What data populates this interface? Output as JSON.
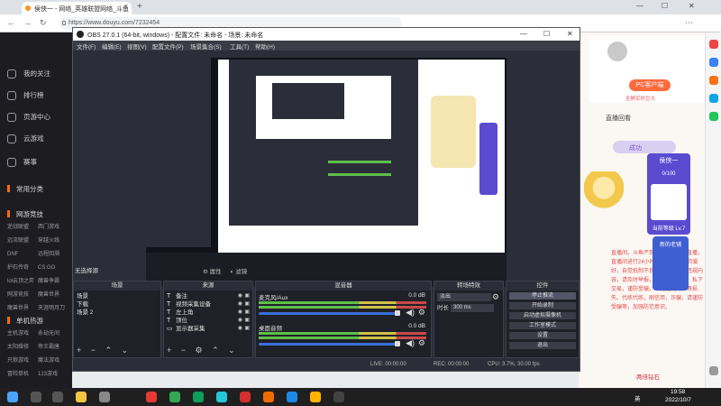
{
  "browser": {
    "tab_title": "侯侠一 - 网络_英雄联盟网络_斗鱼",
    "url": "https://www.douyu.com/7232454",
    "new_tab_symbol": "+",
    "close_symbol": "×",
    "win_min": "—",
    "win_max": "☐",
    "win_close": "✕"
  },
  "sidebar": {
    "items": [
      {
        "label": "我的关注"
      },
      {
        "label": "排行榜"
      },
      {
        "label": "页游中心"
      },
      {
        "label": "云游戏"
      },
      {
        "label": "赛事"
      }
    ],
    "section_common": "常用分类",
    "section_online": "网游竞技",
    "online_games": [
      "逆战联盟",
      "西门游戏",
      "远流联盟",
      "穿越火线",
      "DNF",
      "远程回溯",
      "护石传奇",
      "CS:GO",
      "lol云顶之弈",
      "魔兽争霸",
      "网游竞技",
      "魔兽世界",
      "魔兽世界",
      "天涯明月刀"
    ],
    "section_mobile": "单机热游",
    "mobile_games": [
      "主机游戏",
      "永劫无间",
      "太阳维修",
      "帝王霸唐",
      "只狼游戏",
      "魔法游戏",
      "冒险单机",
      "123游戏",
      "英雄联盟"
    ]
  },
  "obs": {
    "title": "OBS 27.0.1 (64-bit, windows) - 配置文件: 未命名 - 场景: 未命名",
    "menu": [
      "文件(F)",
      "编辑(E)",
      "视图(V)",
      "配置文件(P)",
      "场景集合(S)",
      "工具(T)",
      "帮助(H)"
    ],
    "no_source": "无选择源",
    "props_btn": "属性",
    "filters_btn": "滤镜",
    "scenes_header": "场景",
    "scenes": [
      "场景",
      "下载",
      "场景 2"
    ],
    "sources_header": "来源",
    "sources": [
      {
        "label": "备注",
        "icon": "T"
      },
      {
        "label": "视频采集设备",
        "icon": "T"
      },
      {
        "label": "左上角",
        "icon": "T"
      },
      {
        "label": "顶位",
        "icon": "T"
      },
      {
        "label": "显示器采集",
        "icon": "▭"
      }
    ],
    "mixer_header": "混音器",
    "mixer": [
      {
        "name": "麦克风/Aux",
        "db": "0.0 dB"
      },
      {
        "name": "桌面音频",
        "db": "0.0 dB"
      }
    ],
    "transitions_header": "转场特效",
    "transition_value": "淡出",
    "duration_label": "时长",
    "duration_value": "300 ms",
    "controls_header": "控件",
    "controls": [
      "停止推流",
      "开始录制",
      "启动虚拟摄像机",
      "工作室模式",
      "设置",
      "退出"
    ],
    "status": {
      "live": "LIVE: 00:00:00",
      "rec": "REC: 00:00:00",
      "cpu": "CPU: 3.7%, 30.00 fps"
    }
  },
  "right_page": {
    "pc_button": "PC客户端",
    "pc_sub": "全屏实时巨大",
    "live_link": "直播回看",
    "pill": "成功",
    "announcement": "直播间。斗鱼严禁未成年人进行直播，直播间进行24小时监督。请大家的爱好，自觉抵制不良信息，如发现违规内容，请及时举报，加强对直播中，私下交易，谨防受骗，以免造成财产等损失。代练代练，刷信用，诈骗，请谨防受骗等，加强防范意识。",
    "panel_title": "侯侠一",
    "panel_progress": "0/100",
    "panel_level": "当前等级 Lv.7",
    "panel2_title": "新的老铺",
    "badge": "关心",
    "footer_link": "两倍钻石"
  },
  "taskbar": {
    "lang": "英",
    "time": "19:58",
    "date": "2022/10/7"
  }
}
